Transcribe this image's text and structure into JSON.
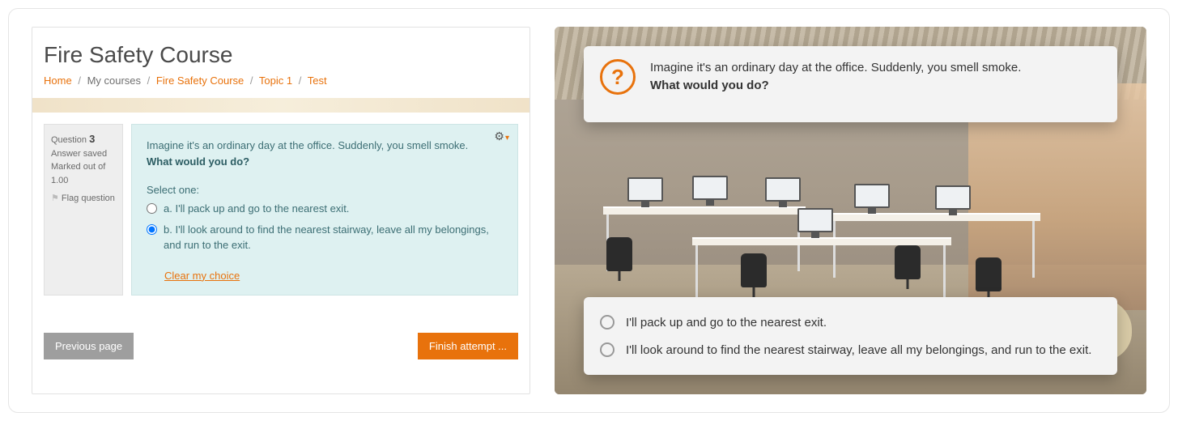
{
  "lms": {
    "title": "Fire Safety Course",
    "breadcrumb": {
      "home": "Home",
      "my_courses": "My courses",
      "course": "Fire Safety Course",
      "topic": "Topic 1",
      "test": "Test"
    },
    "question_info": {
      "label": "Question",
      "number": "3",
      "status": "Answer saved",
      "marked_label": "Marked out of",
      "marked_value": "1.00",
      "flag": "Flag question"
    },
    "question": {
      "prompt_line1": "Imagine it's an ordinary day at the office. Suddenly, you smell smoke.",
      "prompt_line2": "What would you do?",
      "select_one": "Select one:",
      "options": [
        {
          "letter": "a.",
          "text": "I'll pack up and go to the nearest exit.",
          "selected": false
        },
        {
          "letter": "b.",
          "text": "I'll look around to find the nearest stairway, leave all my belongings, and run to the exit.",
          "selected": true
        }
      ],
      "clear": "Clear my choice"
    },
    "nav": {
      "prev": "Previous page",
      "finish": "Finish attempt ..."
    }
  },
  "slide": {
    "prompt_line1": "Imagine it's an ordinary day at the office. Suddenly, you smell smoke.",
    "prompt_line2": "What would you do?",
    "options": [
      "I'll pack up and go to the nearest exit.",
      "I'll look around to find the nearest stairway, leave all my belongings, and run to the exit."
    ]
  }
}
